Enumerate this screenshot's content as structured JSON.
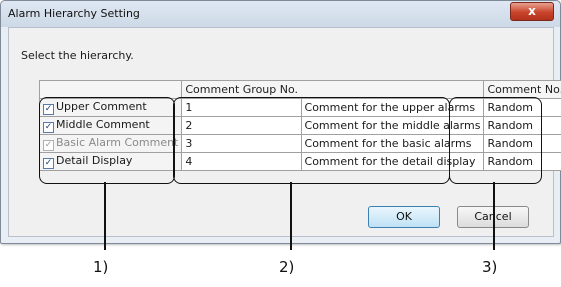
{
  "window": {
    "title": "Alarm Hierarchy Setting",
    "close_glyph": "x"
  },
  "instruction": "Select the hierarchy.",
  "table": {
    "headers": [
      "",
      "Comment Group No.",
      "",
      "Comment No."
    ],
    "rows": [
      {
        "checked": true,
        "enabled": true,
        "label": "Upper Comment",
        "group_no": "1",
        "group_comment": "Comment for the upper alarms",
        "comment_no": "Random"
      },
      {
        "checked": true,
        "enabled": true,
        "label": "Middle Comment",
        "group_no": "2",
        "group_comment": "Comment for the middle alarms",
        "comment_no": "Random"
      },
      {
        "checked": true,
        "enabled": false,
        "label": "Basic Alarm Comment",
        "group_no": "3",
        "group_comment": "Comment for the basic alarms",
        "comment_no": "Random"
      },
      {
        "checked": true,
        "enabled": true,
        "label": "Detail Display",
        "group_no": "4",
        "group_comment": "Comment for the detail display",
        "comment_no": "Random"
      }
    ]
  },
  "buttons": {
    "ok": "OK",
    "cancel": "Cancel"
  },
  "callouts": [
    "1)",
    "2)",
    "3)"
  ],
  "colors": {
    "close_button": "#c9442b",
    "default_button_border": "#3c7fb1",
    "check_mark": "#1d3f78"
  },
  "icons": {
    "checkbox_checked": "check-mark-icon",
    "close": "close-icon"
  }
}
